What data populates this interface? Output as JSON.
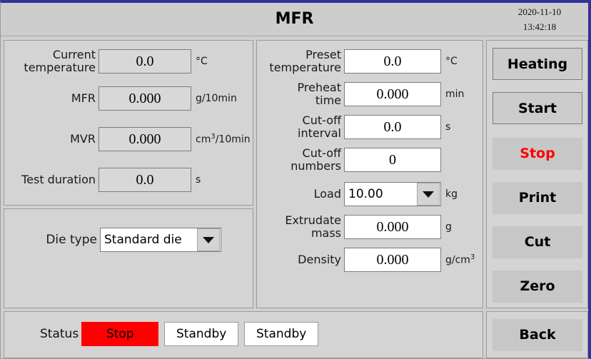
{
  "header": {
    "title": "MFR",
    "date": "2020-11-10",
    "time": "13:42:18"
  },
  "results": {
    "fields": [
      {
        "label": "Current temperature",
        "value": "0.0",
        "unit": "°C"
      },
      {
        "label": "MFR",
        "value": "0.000",
        "unit": "g/10min"
      },
      {
        "label": "MVR",
        "value": "0.000",
        "unit": "cm3/10min"
      },
      {
        "label": "Test duration",
        "value": "0.0",
        "unit": "s"
      }
    ]
  },
  "die": {
    "label": "Die type",
    "value": "Standard die",
    "arrow_icon": "chevron-down-icon"
  },
  "params": {
    "fields": [
      {
        "label": "Preset temperature",
        "value": "0.0",
        "unit": "°C"
      },
      {
        "label": "Preheat time",
        "value": "0.000",
        "unit": "min"
      },
      {
        "label": "Cut-off interval",
        "value": "0.0",
        "unit": "s"
      },
      {
        "label": "Cut-off numbers",
        "value": "0",
        "unit": ""
      }
    ],
    "load": {
      "label": "Load",
      "value": "10.00",
      "unit": "kg",
      "arrow_icon": "chevron-down-icon"
    },
    "extrudate": {
      "label": "Extrudate mass",
      "value": "0.000",
      "unit": "g"
    },
    "density": {
      "label": "Density",
      "value": "0.000",
      "unit": "g/cm3"
    }
  },
  "actions": {
    "buttons": [
      {
        "label": "Heating",
        "style": "framed"
      },
      {
        "label": "Start",
        "style": "framed"
      },
      {
        "label": "Stop",
        "style": "danger"
      },
      {
        "label": "Print",
        "style": "flat"
      },
      {
        "label": "Cut",
        "style": "flat"
      },
      {
        "label": "Zero",
        "style": "flat"
      }
    ],
    "back": {
      "label": "Back"
    }
  },
  "status": {
    "label": "Status",
    "items": [
      {
        "text": "Stop",
        "state": "alarm"
      },
      {
        "text": "Standby",
        "state": "plain"
      },
      {
        "text": "Standby",
        "state": "plain"
      }
    ],
    "alarm_color": "#ff0000"
  }
}
